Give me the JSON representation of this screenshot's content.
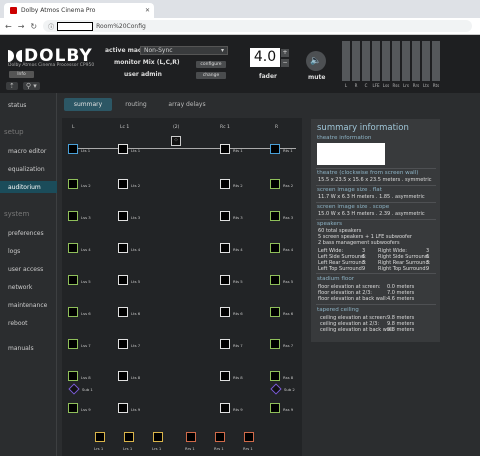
{
  "browser": {
    "tab_title": "Dolby Atmos Cinema Pro",
    "url_suffix": "Room%20Config"
  },
  "header": {
    "brand": "DOLBY",
    "subtitle": "Dolby Atmos Cinema Processor CP950",
    "info_label": "Info",
    "active_macro_label": "active macro",
    "active_macro_value": "Non-Sync",
    "monitor_label": "monitor Mix (L,C,R)",
    "user_label": "user admin",
    "configure_label": "configure",
    "change_label": "change",
    "fader_value": "4.0",
    "fader_label": "fader",
    "mute_label": "mute",
    "meters": [
      "L",
      "R",
      "C",
      "LFE",
      "Lss",
      "Rss",
      "Lrs",
      "Rrs",
      "Lts",
      "Rts"
    ]
  },
  "sidebar": {
    "status": "status",
    "setup": "setup",
    "macro_editor": "macro editor",
    "equalization": "equalization",
    "auditorium": "auditorium",
    "system": "system",
    "preferences": "preferences",
    "logs": "logs",
    "user_access": "user access",
    "network": "network",
    "maintenance": "maintenance",
    "reboot": "reboot",
    "manuals": "manuals"
  },
  "tabs": {
    "summary": "summary",
    "routing": "routing",
    "array_delays": "array delays"
  },
  "grid": {
    "col_L": "L",
    "col_Lc": "Lc 1",
    "col_C": "(2)",
    "col_Rc": "Rc 1",
    "col_R": "R",
    "top": [
      "Lts 1",
      "Lts 1",
      "Rts 1",
      "Rts 1"
    ],
    "left": [
      "Lss 2",
      "Lss 3",
      "Lss 4",
      "Lss 5",
      "Lss 6",
      "Lss 7",
      "Lss 8",
      "Lss 9"
    ],
    "lc": [
      "Lts 2",
      "Lts 3",
      "Lts 4",
      "Lts 5",
      "Lts 6",
      "Lts 7",
      "Lts 8",
      "Lts 9"
    ],
    "rc": [
      "Rts 2",
      "Rts 3",
      "Rts 4",
      "Rts 5",
      "Rts 6",
      "Rts 7",
      "Rts 8",
      "Rts 9"
    ],
    "right": [
      "Rss 2",
      "Rss 3",
      "Rss 4",
      "Rss 5",
      "Rss 6",
      "Rss 7",
      "Rss 8",
      "Rss 9"
    ],
    "sub_left": "Sub 1",
    "sub_right": "Sub 2",
    "rear": [
      "Lrs 1",
      "Lrs 1",
      "Lrs 1",
      "Rrs 1",
      "Rrs 1",
      "Rrs 1"
    ],
    "colors": {
      "screen": "#4aa0d8",
      "surround": "#8fbf5a",
      "top": "#e0e0e0",
      "rear_l": "#d9b44a",
      "rear_r": "#d06a4a",
      "sub": "#7a5cd6"
    }
  },
  "summary": {
    "title": "summary information",
    "theatre_info": "theatre information",
    "dims_head": "theatre (clockwise from screen wall)",
    "dims": "15.5 x 23.5 x 15.6 x 23.5 meters . symmetric",
    "flat_head": "screen image size . flat",
    "flat": "11.7 W x 6.3 H meters . 1.85 . asymmetric",
    "scope_head": "screen image size . scope",
    "scope": "15.0 W x 6.3 H meters . 2.39 . asymmetric",
    "spk_head": "speakers",
    "spk1": "60 total speakers",
    "spk2": "5 screen speakers + 1 LFE subwoofer",
    "spk3": "2 bass management subwoofers",
    "counts": [
      [
        "Left Wide:",
        "3",
        "Right Wide:",
        "3"
      ],
      [
        "Left Side Surround:",
        "6",
        "Right Side Surround:",
        "6"
      ],
      [
        "Left Rear Surround:",
        "3",
        "Right Rear Surround:",
        "3"
      ],
      [
        "Left Top Surround:",
        "9",
        "Right Top Surround:",
        "9"
      ]
    ],
    "stadium_head": "stadium floor",
    "stadium": [
      [
        "floor elevation at screen:",
        "0.0 meters"
      ],
      [
        "floor elevation at 2/3:",
        "7.0 meters"
      ],
      [
        "floor elevation at back wall:",
        "4.6 meters"
      ]
    ],
    "ceiling_head": "tapered ceiling",
    "ceiling": [
      [
        "ceiling elevation at screen:",
        "9.8 meters"
      ],
      [
        "ceiling elevation at 2/3:",
        "9.8 meters"
      ],
      [
        "ceiling elevation at back wall:",
        "9.8 meters"
      ]
    ]
  }
}
